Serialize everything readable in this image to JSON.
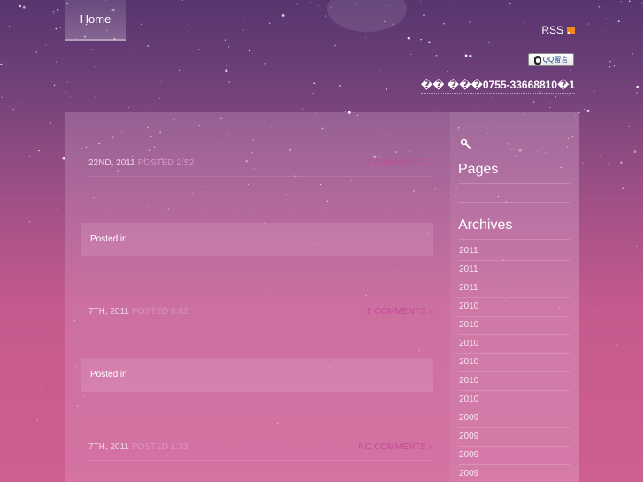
{
  "nav": {
    "home_label": "Home"
  },
  "header": {
    "rss_label": "RSS",
    "qq_label": "QQ留言",
    "phone_text": "�� ���0755-33668810�1"
  },
  "posts": [
    {
      "date": "22ND, 2011",
      "posted": "POSTED 2:52",
      "comments": "2 COMMENTS »",
      "posted_in": "Posted in"
    },
    {
      "date": "7TH, 2011",
      "posted": "POSTED 8:42",
      "comments": "6 COMMENTS »",
      "posted_in": "Posted in"
    },
    {
      "date": "7TH, 2011",
      "posted": "POSTED 1:33",
      "comments": "NO COMMENTS »"
    }
  ],
  "sidebar": {
    "pages_title": "Pages",
    "archives_title": "Archives",
    "archives": [
      "2011",
      "2011",
      "2011",
      "2010",
      "2010",
      "2010",
      "2010",
      "2010",
      "2010",
      "2009",
      "2009",
      "2009",
      "2009"
    ]
  },
  "colors": {
    "comment_link": "#c8479a",
    "rss_orange": "#f3891e"
  }
}
